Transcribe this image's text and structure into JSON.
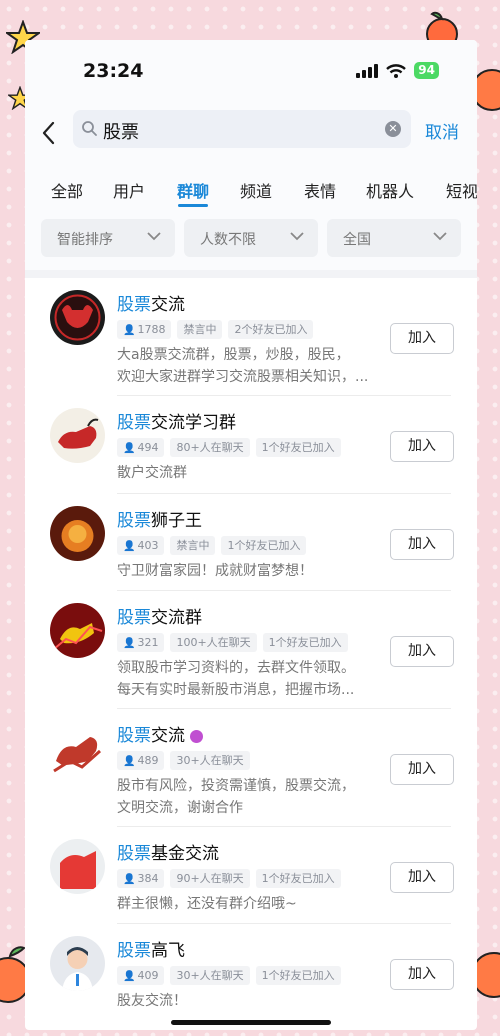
{
  "status_bar": {
    "time": "23:24",
    "battery": "94"
  },
  "search": {
    "query": "股票",
    "cancel_label": "取消"
  },
  "tabs": [
    {
      "label": "全部"
    },
    {
      "label": "用户"
    },
    {
      "label": "群聊"
    },
    {
      "label": "频道"
    },
    {
      "label": "表情"
    },
    {
      "label": "机器人"
    },
    {
      "label": "短视"
    }
  ],
  "active_tab": "群聊",
  "filters": [
    {
      "label": "智能排序"
    },
    {
      "label": "人数不限"
    },
    {
      "label": "全国"
    }
  ],
  "groups": [
    {
      "name_highlight": "股票",
      "name_rest": "交流",
      "chips": [
        "1788",
        "禁言中",
        "2个好友已加入"
      ],
      "desc": [
        "大a股票交流群，股票，炒股，股民，",
        "欢迎大家进群学习交流股票相关知识，..."
      ],
      "join_label": "加入"
    },
    {
      "name_highlight": "股票",
      "name_rest": "交流学习群",
      "chips": [
        "494",
        "80+人在聊天",
        "1个好友已加入"
      ],
      "desc": [
        "散户交流群"
      ],
      "join_label": "加入"
    },
    {
      "name_highlight": "股票",
      "name_rest": "狮子王",
      "chips": [
        "403",
        "禁言中",
        "1个好友已加入"
      ],
      "desc": [
        "守卫财富家园！成就财富梦想！"
      ],
      "join_label": "加入"
    },
    {
      "name_highlight": "股票",
      "name_rest": "交流群",
      "chips": [
        "321",
        "100+人在聊天",
        "1个好友已加入"
      ],
      "desc": [
        "领取股市学习资料的，去群文件领取。",
        "每天有实时最新股市消息，把握市场..."
      ],
      "join_label": "加入"
    },
    {
      "name_highlight": "股票",
      "name_rest": "交流",
      "chips": [
        "489",
        "30+人在聊天"
      ],
      "desc": [
        "股市有风险，投资需谨慎，股票交流，",
        "文明交流，谢谢合作"
      ],
      "join_label": "加入"
    },
    {
      "name_highlight": "股票",
      "name_rest": "基金交流",
      "chips": [
        "384",
        "90+人在聊天",
        "1个好友已加入"
      ],
      "desc": [
        "群主很懒，还没有群介绍哦~"
      ],
      "join_label": "加入"
    },
    {
      "name_highlight": "股票",
      "name_rest": "高飞",
      "chips": [
        "409",
        "30+人在聊天",
        "1个好友已加入"
      ],
      "desc": [
        "股友交流！"
      ],
      "join_label": "加入"
    }
  ],
  "colors": {
    "accent": "#1a88d8",
    "background_frame": "#f7d9de"
  }
}
